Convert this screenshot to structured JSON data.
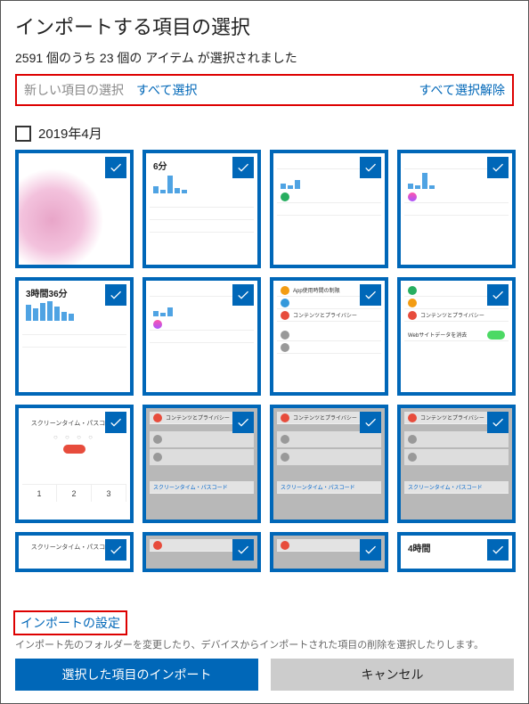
{
  "header": {
    "title": "インポートする項目の選択",
    "subtitle": "2591 個のうち 23 個の アイテム が選択されました"
  },
  "selection_bar": {
    "label": "新しい項目の選択",
    "select_all": "すべて選択",
    "deselect_all": "すべて選択解除"
  },
  "group": {
    "label": "2019年4月"
  },
  "thumbnails": {
    "t2_title": "6分",
    "t5_title": "3時間36分",
    "passcode_title": "スクリーンタイム・パスコード",
    "nums": {
      "n1": "1",
      "n2": "2",
      "n3": "3"
    },
    "t16_title": "4時間"
  },
  "footer": {
    "settings_link": "インポートの設定",
    "description": "インポート先のフォルダーを変更したり、デバイスからインポートされた項目の削除を選択したりします。",
    "import_button": "選択した項目のインポート",
    "cancel_button": "キャンセル"
  }
}
